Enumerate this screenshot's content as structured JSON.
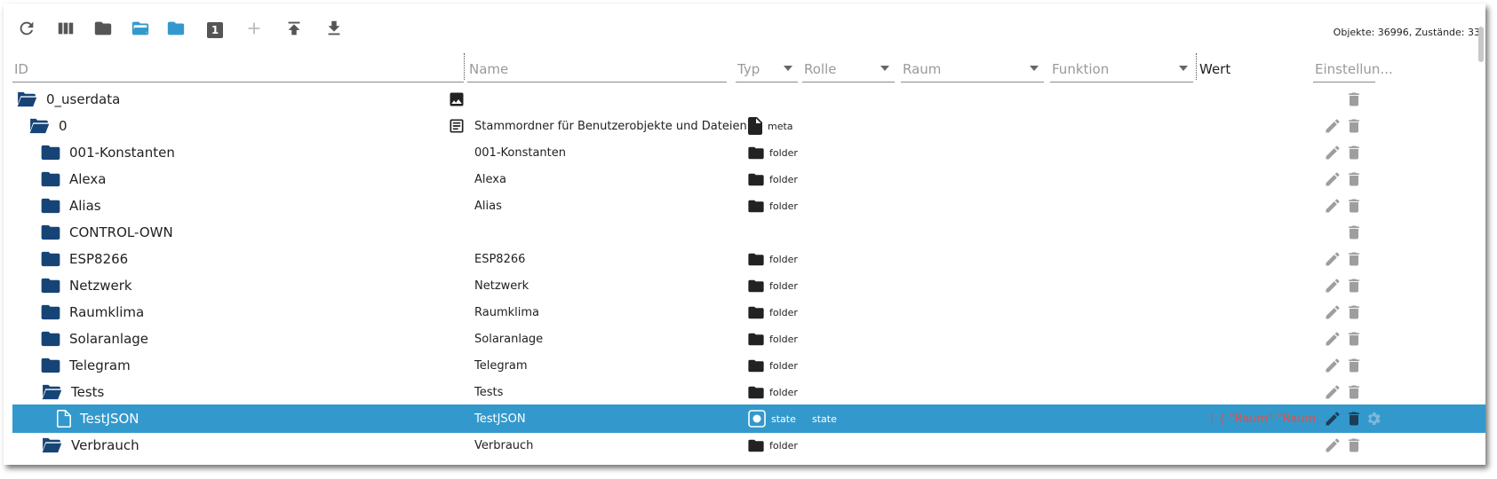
{
  "toolbar": {
    "buttons": [
      {
        "icon": "refresh-icon"
      },
      {
        "icon": "columns-icon"
      },
      {
        "icon": "folder-closed-icon"
      },
      {
        "icon": "folder-open-icon"
      },
      {
        "icon": "folder-blue-icon"
      },
      {
        "icon": "expand-level-icon",
        "label": "1"
      },
      {
        "icon": "plus-icon"
      },
      {
        "icon": "upload-icon"
      },
      {
        "icon": "download-icon"
      }
    ],
    "stats": "Objekte: 36996, Zustände: 33"
  },
  "columns": {
    "id": "ID",
    "name": "Name",
    "typ": "Typ",
    "rolle": "Rolle",
    "raum": "Raum",
    "funktion": "Funktion",
    "wert": "Wert",
    "einstellungen": "Einstellun..."
  },
  "rows": [
    {
      "id": "0_userdata",
      "name": "",
      "typ": "",
      "role": "",
      "value": "",
      "icon": "folder-open-icon",
      "name_icon": "image-icon",
      "typ_icon": "",
      "edit": false,
      "delete": true
    },
    {
      "id": "0",
      "name": "Stammordner für Benutzerobjekte und Dateien",
      "typ": "meta",
      "role": "",
      "value": "",
      "icon": "folder-open-icon",
      "name_icon": "description-icon",
      "typ_icon": "file-icon",
      "edit": true,
      "delete": true
    },
    {
      "id": "001-Konstanten",
      "name": "001-Konstanten",
      "typ": "folder",
      "role": "",
      "value": "",
      "icon": "folder-icon",
      "typ_icon": "folder-icon",
      "edit": true,
      "delete": true
    },
    {
      "id": "Alexa",
      "name": "Alexa",
      "typ": "folder",
      "role": "",
      "value": "",
      "icon": "folder-icon",
      "typ_icon": "folder-icon",
      "edit": true,
      "delete": true
    },
    {
      "id": "Alias",
      "name": "Alias",
      "typ": "folder",
      "role": "",
      "value": "",
      "icon": "folder-icon",
      "typ_icon": "folder-icon",
      "edit": true,
      "delete": true
    },
    {
      "id": "CONTROL-OWN",
      "name": "",
      "typ": "",
      "role": "",
      "value": "",
      "icon": "folder-icon",
      "typ_icon": "",
      "edit": false,
      "delete": true
    },
    {
      "id": "ESP8266",
      "name": "ESP8266",
      "typ": "folder",
      "role": "",
      "value": "",
      "icon": "folder-icon",
      "typ_icon": "folder-icon",
      "edit": true,
      "delete": true
    },
    {
      "id": "Netzwerk",
      "name": "Netzwerk",
      "typ": "folder",
      "role": "",
      "value": "",
      "icon": "folder-icon",
      "typ_icon": "folder-icon",
      "edit": true,
      "delete": true
    },
    {
      "id": "Raumklima",
      "name": "Raumklima",
      "typ": "folder",
      "role": "",
      "value": "",
      "icon": "folder-icon",
      "typ_icon": "folder-icon",
      "edit": true,
      "delete": true
    },
    {
      "id": "Solaranlage",
      "name": "Solaranlage",
      "typ": "folder",
      "role": "",
      "value": "",
      "icon": "folder-icon",
      "typ_icon": "folder-icon",
      "edit": true,
      "delete": true
    },
    {
      "id": "Telegram",
      "name": "Telegram",
      "typ": "folder",
      "role": "",
      "value": "",
      "icon": "folder-icon",
      "typ_icon": "folder-icon",
      "edit": true,
      "delete": true
    },
    {
      "id": "Tests",
      "name": "Tests",
      "typ": "folder",
      "role": "",
      "value": "",
      "icon": "folder-open-icon",
      "typ_icon": "folder-icon",
      "edit": true,
      "delete": true
    },
    {
      "id": "TestJSON",
      "name": "TestJSON",
      "typ": "state",
      "role": "state",
      "value": "[ { \"Raum\":\"Raum...",
      "icon": "file-outline-icon",
      "typ_icon": "state-icon",
      "edit": true,
      "delete": true,
      "settings": true,
      "selected": true
    },
    {
      "id": "Verbrauch",
      "name": "Verbrauch",
      "typ": "folder",
      "role": "",
      "value": "",
      "icon": "folder-open-icon",
      "typ_icon": "folder-icon",
      "edit": true,
      "delete": true
    }
  ],
  "colors": {
    "folder": "#164477",
    "folder_light": "#3399cc",
    "selection": "#3399cc",
    "value_red": "#d9534f",
    "action_gray": "#9e9e9e"
  }
}
